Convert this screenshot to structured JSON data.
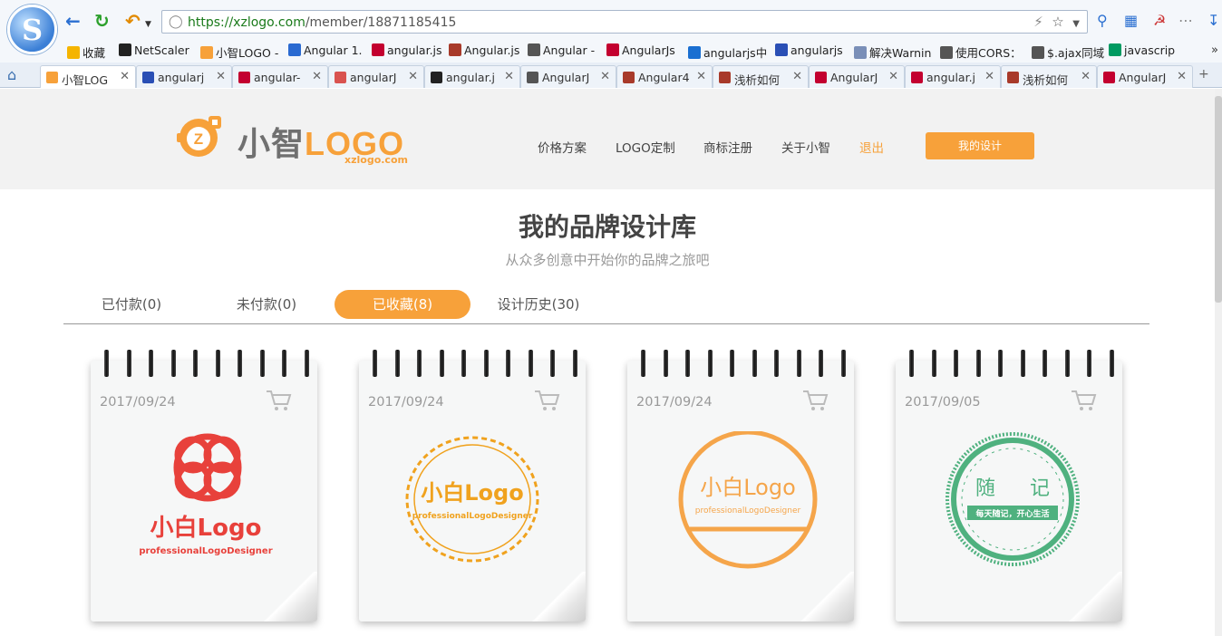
{
  "browser": {
    "url_host": "https://xzlogo.com",
    "url_path": "/member/18871185415"
  },
  "bookmarks": [
    {
      "label": "收藏",
      "color": "#f5b400"
    },
    {
      "label": "NetScaler",
      "color": "#222222"
    },
    {
      "label": "小智LOGO -",
      "color": "#f7a13a"
    },
    {
      "label": "Angular 1.",
      "color": "#2a6ad1"
    },
    {
      "label": "angular.js",
      "color": "#c3002f"
    },
    {
      "label": "Angular.js",
      "color": "#a83a2a"
    },
    {
      "label": "Angular -",
      "color": "#555555"
    },
    {
      "label": "AngularJs",
      "color": "#c3002f"
    },
    {
      "label": "angularjs中",
      "color": "#1a6fd1"
    },
    {
      "label": "angularjs",
      "color": "#2a4fb5"
    },
    {
      "label": "解决Warnin",
      "color": "#7a8fb8"
    },
    {
      "label": "使用CORS：",
      "color": "#555555"
    },
    {
      "label": "$.ajax同域",
      "color": "#555555"
    },
    {
      "label": "javascrip",
      "color": "#009a61"
    }
  ],
  "tabs": [
    {
      "label": "小智LOG",
      "color": "#f7a13a",
      "active": true
    },
    {
      "label": "angularj",
      "color": "#2a4fb5"
    },
    {
      "label": "angular-",
      "color": "#c3002f"
    },
    {
      "label": "angularJ",
      "color": "#d9534f"
    },
    {
      "label": "angular.j",
      "color": "#222222"
    },
    {
      "label": "AngularJ",
      "color": "#555555"
    },
    {
      "label": "Angular4",
      "color": "#a83a2a"
    },
    {
      "label": "浅析如何",
      "color": "#a83a2a"
    },
    {
      "label": "AngularJ",
      "color": "#c3002f"
    },
    {
      "label": "angular.j",
      "color": "#c3002f"
    },
    {
      "label": "浅析如何",
      "color": "#a83a2a"
    },
    {
      "label": "AngularJ",
      "color": "#c3002f"
    }
  ],
  "site": {
    "logo_cn": "小智",
    "logo_en": "LOGO",
    "logo_domain": "xzlogo.com",
    "nav": [
      "价格方案",
      "LOGO定制",
      "商标注册",
      "关于小智"
    ],
    "logout": "退出",
    "my_design": "我的设计",
    "accent": "#f7a13a"
  },
  "main": {
    "title": "我的品牌设计库",
    "subtitle": "从众多创意中开始你的品牌之旅吧",
    "tabs": [
      {
        "label": "已付款(0)"
      },
      {
        "label": "未付款(0)"
      },
      {
        "label": "已收藏(8)",
        "active": true
      },
      {
        "label": "设计历史(30)"
      }
    ],
    "cards": [
      {
        "date": "2017/09/24",
        "logo_title": "小白Logo",
        "logo_sub": "professionalLogoDesigner",
        "color": "#e8413b"
      },
      {
        "date": "2017/09/24",
        "logo_title": "小白Logo",
        "logo_sub": "professionalLogoDesigner",
        "color": "#f0a21e"
      },
      {
        "date": "2017/09/24",
        "logo_title": "小白Logo",
        "logo_sub": "professionalLogoDesigner",
        "color": "#f5a54a"
      },
      {
        "date": "2017/09/05",
        "logo_title_left": "随",
        "logo_title_right": "记",
        "logo_sub": "每天随记，开心生活",
        "color": "#4fb17f"
      }
    ]
  }
}
